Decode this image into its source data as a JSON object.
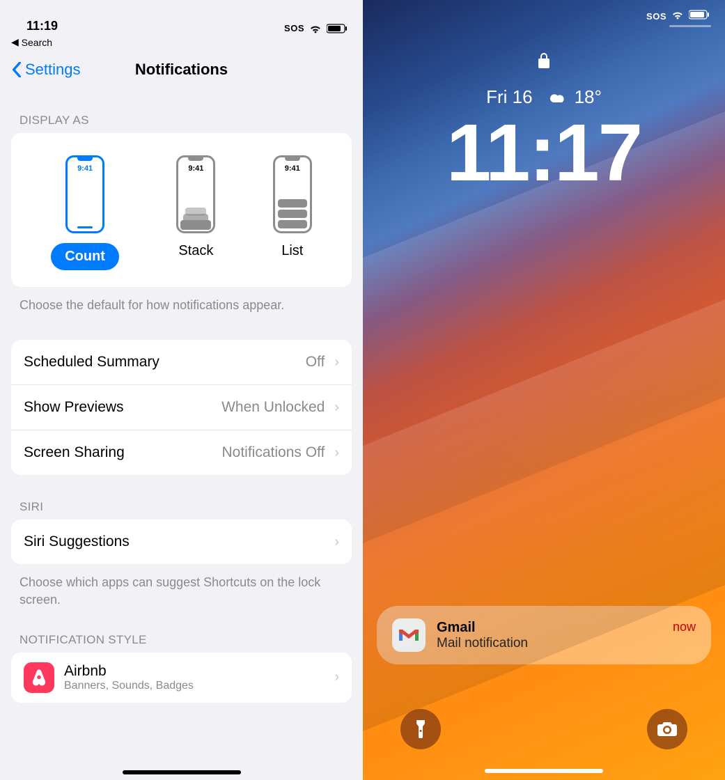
{
  "settings": {
    "status": {
      "time": "11:19",
      "sos": "SOS"
    },
    "backSearch": "Search",
    "nav": {
      "back": "Settings",
      "title": "Notifications"
    },
    "displayAs": {
      "header": "DISPLAY AS",
      "options": [
        {
          "label": "Count",
          "time": "9:41"
        },
        {
          "label": "Stack",
          "time": "9:41"
        },
        {
          "label": "List",
          "time": "9:41"
        }
      ],
      "footer": "Choose the default for how notifications appear."
    },
    "rows": [
      {
        "label": "Scheduled Summary",
        "value": "Off"
      },
      {
        "label": "Show Previews",
        "value": "When Unlocked"
      },
      {
        "label": "Screen Sharing",
        "value": "Notifications Off"
      }
    ],
    "siri": {
      "header": "SIRI",
      "row": "Siri Suggestions",
      "footer": "Choose which apps can suggest Shortcuts on the lock screen."
    },
    "style": {
      "header": "NOTIFICATION STYLE",
      "app": {
        "name": "Airbnb",
        "sub": "Banners, Sounds, Badges"
      }
    }
  },
  "lock": {
    "status": {
      "sos": "SOS"
    },
    "date": "Fri 16",
    "temp": "18°",
    "time": "11:17",
    "notification": {
      "app": "Gmail",
      "body": "Mail notification",
      "when": "now"
    }
  }
}
